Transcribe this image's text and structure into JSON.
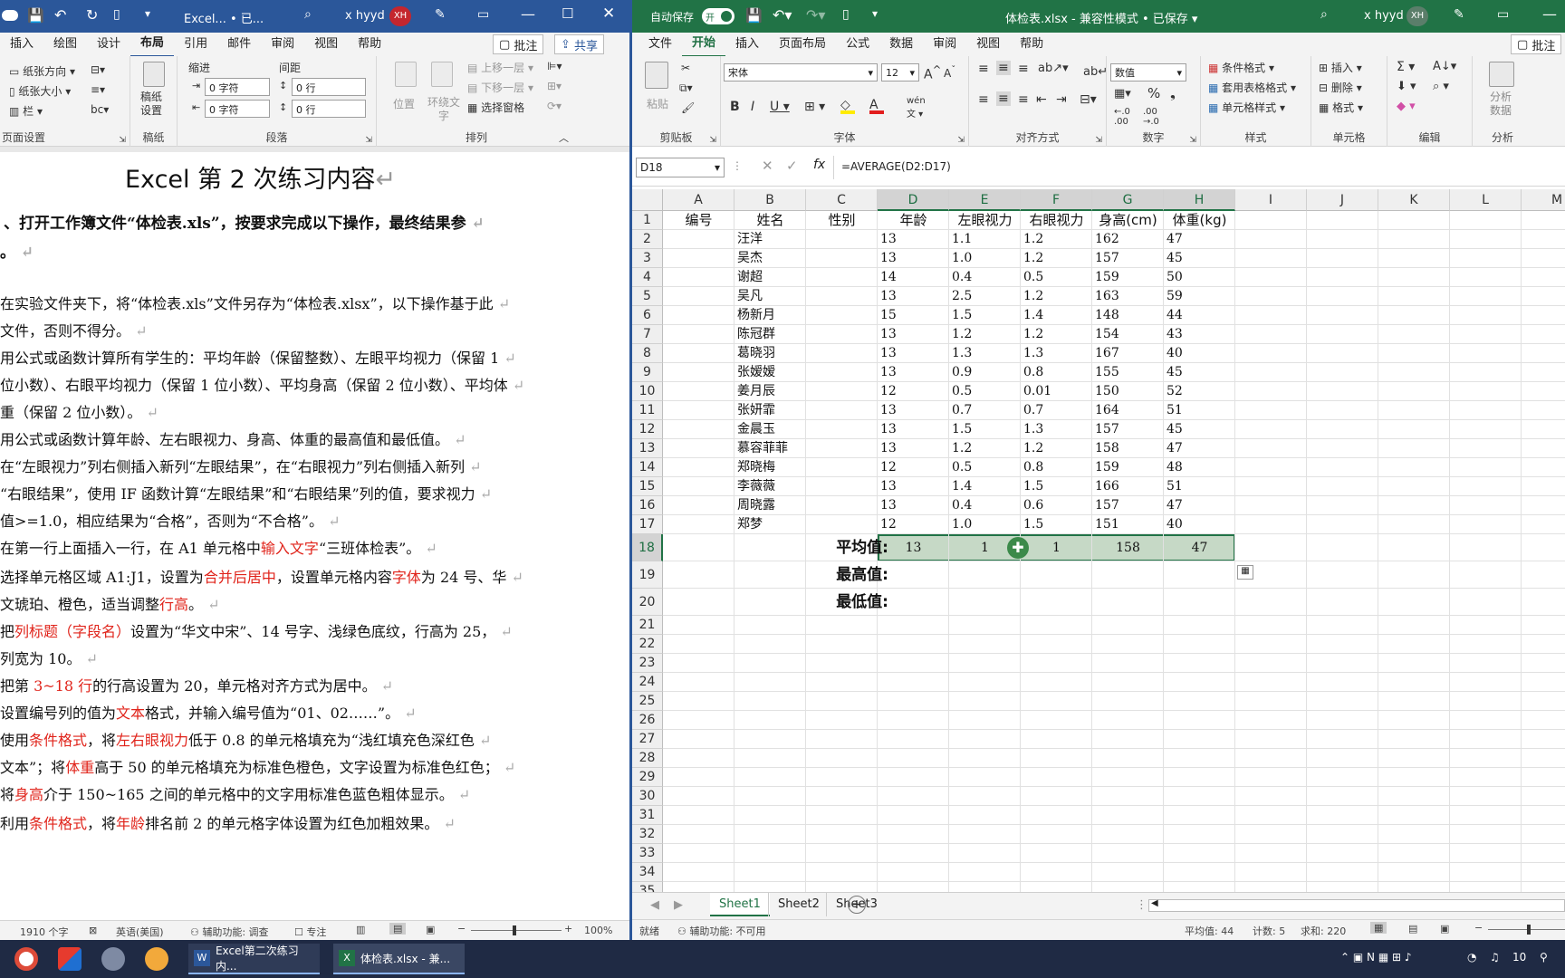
{
  "word": {
    "title": "Excel... • 已...",
    "user": "x hyyd",
    "avatar": "XH",
    "tabs": [
      "插入",
      "绘图",
      "设计",
      "布局",
      "引用",
      "邮件",
      "审阅",
      "视图",
      "帮助"
    ],
    "comment_btn": "批注",
    "share_btn": "共享",
    "ribbon": {
      "orientation": "纸张方向",
      "size": "纸张大小",
      "columns": "栏",
      "group_page_setup": "页面设置",
      "draft": "稿纸\n设置",
      "group_draft": "稿纸",
      "indent_label": "缩进",
      "spacing_label": "间距",
      "indent_left": "0 字符",
      "indent_right": "0 字符",
      "spacing_before": "0 行",
      "spacing_after": "0 行",
      "group_paragraph": "段落",
      "position": "位置",
      "wrap": "环绕文字",
      "bring_forward": "上移一层",
      "send_backward": "下移一层",
      "selection_pane": "选择窗格",
      "group_arrange": "排列"
    },
    "doc": {
      "title": "Excel 第 2 次练习内容",
      "lines": [
        "、打开工作簿文件“体检表.xls”，按要求完成以下操作，最终结果参",
        "。",
        "在实验文件夹下，将“体检表.xls”文件另存为“体检表.xlsx”，以下操作基于此",
        "文件，否则不得分。",
        "用公式或函数计算所有学生的：平均年龄（保留整数）、左眼平均视力（保留 1",
        "位小数）、右眼平均视力（保留 1 位小数）、平均身高（保留 2 位小数）、平均体",
        "重（保留 2 位小数）。",
        "用公式或函数计算年龄、左右眼视力、身高、体重的最高值和最低值。",
        "在“左眼视力”列右侧插入新列“左眼结果”，在“右眼视力”列右侧插入新列",
        "“右眼结果”，使用 IF 函数计算“左眼结果”和“右眼结果”列的值，要求视力",
        "值>=1.0，相应结果为“合格”，否则为“不合格”。",
        "在第一行上面插入一行，在 A1 单元格中输入文字“三班体检表”。",
        "选择单元格区域 A1:J1，设置为合并后居中，设置单元格内容字体为 24 号、华",
        "文琥珀、橙色，适当调整行高。",
        "把列标题（字段名）设置为“华文中宋”、14 号字、浅绿色底纹，行高为 25，",
        "列宽为 10。",
        "把第 3~18 行的行高设置为 20，单元格对齐方式为居中。",
        "设置编号列的值为文本格式，并输入编号值为“01、02……”。",
        "    使用条件格式，将左右眼视力低于 0.8 的单元格填充为“浅红填充色深红色",
        "文本”；将体重高于 50 的单元格填充为标准色橙色，文字设置为标准色红色；",
        "将身高介于 150~165 之间的单元格中的文字用标准色蓝色粗体显示。",
        "    利用条件格式，将年龄排名前 2 的单元格字体设置为红色加粗效果。"
      ]
    },
    "status": {
      "words": "1910 个字",
      "language": "英语(美国)",
      "accessibility": "辅助功能: 调查",
      "focus": "专注",
      "zoom": "100%"
    }
  },
  "excel": {
    "autosave_label": "自动保存",
    "autosave_state": "开",
    "title": "体检表.xlsx - 兼容性模式 • 已保存",
    "user": "x hyyd",
    "avatar": "XH",
    "tabs": [
      "文件",
      "开始",
      "插入",
      "页面布局",
      "公式",
      "数据",
      "审阅",
      "视图",
      "帮助"
    ],
    "comment_btn": "批注",
    "ribbon": {
      "paste": "粘贴",
      "group_clipboard": "剪贴板",
      "font_name": "宋体",
      "font_size": "12",
      "group_font": "字体",
      "group_align": "对齐方式",
      "number_format": "数值",
      "group_number": "数字",
      "cond_format": "条件格式",
      "table_format": "套用表格格式",
      "cell_style": "单元格样式",
      "group_style": "样式",
      "insert": "插入",
      "delete": "删除",
      "format": "格式",
      "group_cells": "单元格",
      "group_edit": "编辑",
      "analyze": "分析\n数据",
      "group_analyze": "分析"
    },
    "name_box": "D18",
    "formula": "=AVERAGE(D2:D17)",
    "columns": [
      "A",
      "B",
      "C",
      "D",
      "E",
      "F",
      "G",
      "H",
      "I",
      "J",
      "K",
      "L",
      "M"
    ],
    "rows": [
      "1",
      "2",
      "3",
      "4",
      "5",
      "6",
      "7",
      "8",
      "9",
      "10",
      "11",
      "12",
      "13",
      "14",
      "15",
      "16",
      "17",
      "18",
      "19",
      "20",
      "21",
      "22",
      "23",
      "24",
      "25",
      "26",
      "27",
      "28",
      "29",
      "30",
      "31",
      "32",
      "33",
      "34",
      "35"
    ],
    "headers": [
      "编号",
      "姓名",
      "性别",
      "年龄",
      "左眼视力",
      "右眼视力",
      "身高(cm)",
      "体重(kg)"
    ],
    "records": [
      [
        "汪洋",
        "13",
        "1.1",
        "1.2",
        "162",
        "47"
      ],
      [
        "吴杰",
        "13",
        "1.0",
        "1.2",
        "157",
        "45"
      ],
      [
        "谢超",
        "14",
        "0.4",
        "0.5",
        "159",
        "50"
      ],
      [
        "吴凡",
        "13",
        "2.5",
        "1.2",
        "163",
        "59"
      ],
      [
        "杨新月",
        "15",
        "1.5",
        "1.4",
        "148",
        "44"
      ],
      [
        "陈冠群",
        "13",
        "1.2",
        "1.2",
        "154",
        "43"
      ],
      [
        "葛晓羽",
        "13",
        "1.3",
        "1.3",
        "167",
        "40"
      ],
      [
        "张嫒嫒",
        "13",
        "0.9",
        "0.8",
        "155",
        "45"
      ],
      [
        "姜月辰",
        "12",
        "0.5",
        "0.01",
        "150",
        "52"
      ],
      [
        "张妍霏",
        "13",
        "0.7",
        "0.7",
        "164",
        "51"
      ],
      [
        "金晨玉",
        "13",
        "1.5",
        "1.3",
        "157",
        "45"
      ],
      [
        "慕容菲菲",
        "13",
        "1.2",
        "1.2",
        "158",
        "47"
      ],
      [
        "郑晓梅",
        "12",
        "0.5",
        "0.8",
        "159",
        "48"
      ],
      [
        "李薇薇",
        "13",
        "1.4",
        "1.5",
        "166",
        "51"
      ],
      [
        "周晓露",
        "13",
        "0.4",
        "0.6",
        "157",
        "47"
      ],
      [
        "郑梦",
        "12",
        "1.0",
        "1.5",
        "151",
        "40"
      ]
    ],
    "avg_label": "平均值:",
    "max_label": "最高值:",
    "min_label": "最低值:",
    "avg_values": [
      "13",
      "1",
      "1",
      "158",
      "47"
    ],
    "sheets": [
      "Sheet1",
      "Sheet2",
      "Sheet3"
    ],
    "status": {
      "ready": "就绪",
      "accessibility": "辅助功能: 不可用",
      "average": "平均值: 44",
      "count": "计数: 5",
      "sum": "求和: 220"
    }
  },
  "taskbar": {
    "word_task": "Excel第二次练习内...",
    "excel_task": "体检表.xlsx - 兼...",
    "time": "10"
  },
  "colors": {
    "word_blue": "#2b579a",
    "excel_green": "#217346",
    "selection": "#c6d9c6"
  }
}
